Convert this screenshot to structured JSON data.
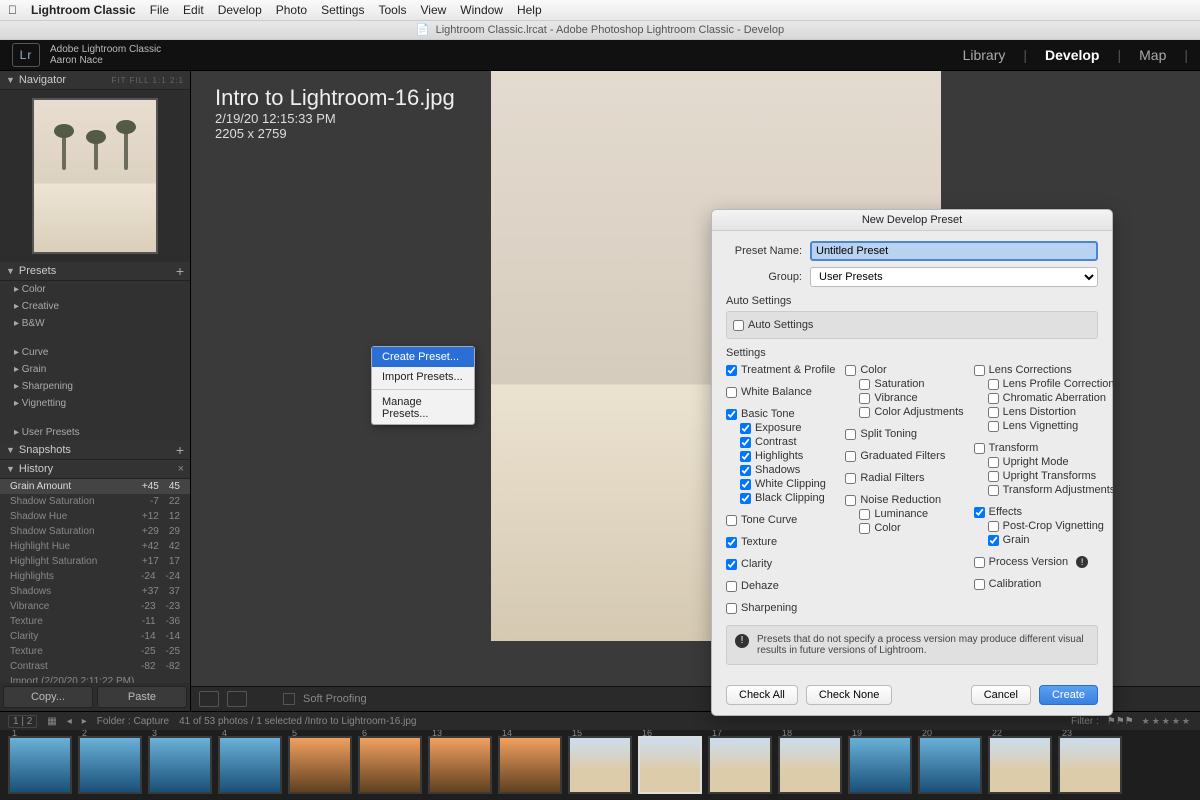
{
  "mac_menu": [
    "Lightroom Classic",
    "File",
    "Edit",
    "Develop",
    "Photo",
    "Settings",
    "Tools",
    "View",
    "Window",
    "Help"
  ],
  "window_title": "Lightroom Classic.lrcat - Adobe Photoshop Lightroom Classic - Develop",
  "id": {
    "app": "Adobe Lightroom Classic",
    "user": "Aaron Nace",
    "logo": "Lr"
  },
  "modules": {
    "library": "Library",
    "develop": "Develop",
    "map": "Map"
  },
  "navigator": {
    "title": "Navigator",
    "modes": "FIT  FILL  1:1  2:1"
  },
  "presets_panel": {
    "title": "Presets",
    "items": [
      "Color",
      "Creative",
      "B&W"
    ],
    "items2": [
      "Curve",
      "Grain",
      "Sharpening",
      "Vignetting"
    ],
    "items3": [
      "User Presets"
    ]
  },
  "ctx": {
    "create": "Create Preset...",
    "import": "Import Presets...",
    "manage": "Manage Presets..."
  },
  "snapshots": "Snapshots",
  "history": {
    "title": "History",
    "rows": [
      {
        "l": "Grain Amount",
        "a": "+45",
        "b": "45",
        "sel": true
      },
      {
        "l": "Shadow Saturation",
        "a": "-7",
        "b": "22"
      },
      {
        "l": "Shadow Hue",
        "a": "+12",
        "b": "12"
      },
      {
        "l": "Shadow Saturation",
        "a": "+29",
        "b": "29"
      },
      {
        "l": "Highlight Hue",
        "a": "+42",
        "b": "42"
      },
      {
        "l": "Highlight Saturation",
        "a": "+17",
        "b": "17"
      },
      {
        "l": "Highlights",
        "a": "-24",
        "b": "-24"
      },
      {
        "l": "Shadows",
        "a": "+37",
        "b": "37"
      },
      {
        "l": "Vibrance",
        "a": "-23",
        "b": "-23"
      },
      {
        "l": "Texture",
        "a": "-11",
        "b": "-36"
      },
      {
        "l": "Clarity",
        "a": "-14",
        "b": "-14"
      },
      {
        "l": "Texture",
        "a": "-25",
        "b": "-25"
      },
      {
        "l": "Contrast",
        "a": "-82",
        "b": "-82"
      },
      {
        "l": "Import (2/20/20 2:11:22 PM)",
        "a": "",
        "b": ""
      }
    ]
  },
  "copy": "Copy...",
  "paste": "Paste",
  "file": {
    "name": "Intro to Lightroom-16.jpg",
    "date": "2/19/20 12:15:33 PM",
    "dim": "2205 x 2759"
  },
  "softproof": "Soft Proofing",
  "dialog": {
    "title": "New Develop Preset",
    "preset_label": "Preset Name:",
    "preset_value": "Untitled Preset",
    "group_label": "Group:",
    "group_value": "User Presets",
    "auto_section": "Auto Settings",
    "auto": "Auto Settings",
    "settings": "Settings",
    "col1": [
      {
        "l": "Treatment & Profile",
        "c": true
      },
      {
        "l": "White Balance",
        "c": false
      },
      {
        "l": "Basic Tone",
        "c": true
      },
      {
        "l": "Exposure",
        "c": true,
        "s": 1
      },
      {
        "l": "Contrast",
        "c": true,
        "s": 1
      },
      {
        "l": "Highlights",
        "c": true,
        "s": 1
      },
      {
        "l": "Shadows",
        "c": true,
        "s": 1
      },
      {
        "l": "White Clipping",
        "c": true,
        "s": 1
      },
      {
        "l": "Black Clipping",
        "c": true,
        "s": 1
      },
      {
        "l": "Tone Curve",
        "c": false
      },
      {
        "l": "Texture",
        "c": true
      },
      {
        "l": "Clarity",
        "c": true
      },
      {
        "l": "Dehaze",
        "c": false
      },
      {
        "l": "Sharpening",
        "c": false
      }
    ],
    "col2": [
      {
        "l": "Color",
        "c": false
      },
      {
        "l": "Saturation",
        "c": false,
        "s": 1
      },
      {
        "l": "Vibrance",
        "c": false,
        "s": 1
      },
      {
        "l": "Color Adjustments",
        "c": false,
        "s": 1
      },
      {
        "l": "Split Toning",
        "c": false
      },
      {
        "l": "Graduated Filters",
        "c": false
      },
      {
        "l": "Radial Filters",
        "c": false
      },
      {
        "l": "Noise Reduction",
        "c": false
      },
      {
        "l": "Luminance",
        "c": false,
        "s": 1
      },
      {
        "l": "Color",
        "c": false,
        "s": 1
      }
    ],
    "col3": [
      {
        "l": "Lens Corrections",
        "c": false
      },
      {
        "l": "Lens Profile Corrections",
        "c": false,
        "s": 1
      },
      {
        "l": "Chromatic Aberration",
        "c": false,
        "s": 1
      },
      {
        "l": "Lens Distortion",
        "c": false,
        "s": 1
      },
      {
        "l": "Lens Vignetting",
        "c": false,
        "s": 1
      },
      {
        "l": "Transform",
        "c": false
      },
      {
        "l": "Upright Mode",
        "c": false,
        "s": 1
      },
      {
        "l": "Upright Transforms",
        "c": false,
        "s": 1
      },
      {
        "l": "Transform Adjustments",
        "c": false,
        "s": 1
      },
      {
        "l": "Effects",
        "c": true
      },
      {
        "l": "Post-Crop Vignetting",
        "c": false,
        "s": 1
      },
      {
        "l": "Grain",
        "c": true,
        "s": 1
      },
      {
        "l": "Process Version",
        "c": false,
        "pv": true
      },
      {
        "l": "Calibration",
        "c": false
      }
    ],
    "notice": "Presets that do not specify a process version may produce different visual results in future versions of Lightroom.",
    "check_all": "Check All",
    "check_none": "Check None",
    "cancel": "Cancel",
    "create": "Create"
  },
  "filmstrip": {
    "nav": "1  |  2",
    "folder": "Folder : Capture",
    "count": "41 of 53 photos / 1 selected  /Intro to Lightroom-16.jpg",
    "filter": "Filter :",
    "nums": [
      "1",
      "2",
      "3",
      "4",
      "5",
      "6",
      "13",
      "14",
      "15",
      "16",
      "17",
      "18",
      "19",
      "20",
      "22",
      "23"
    ]
  }
}
